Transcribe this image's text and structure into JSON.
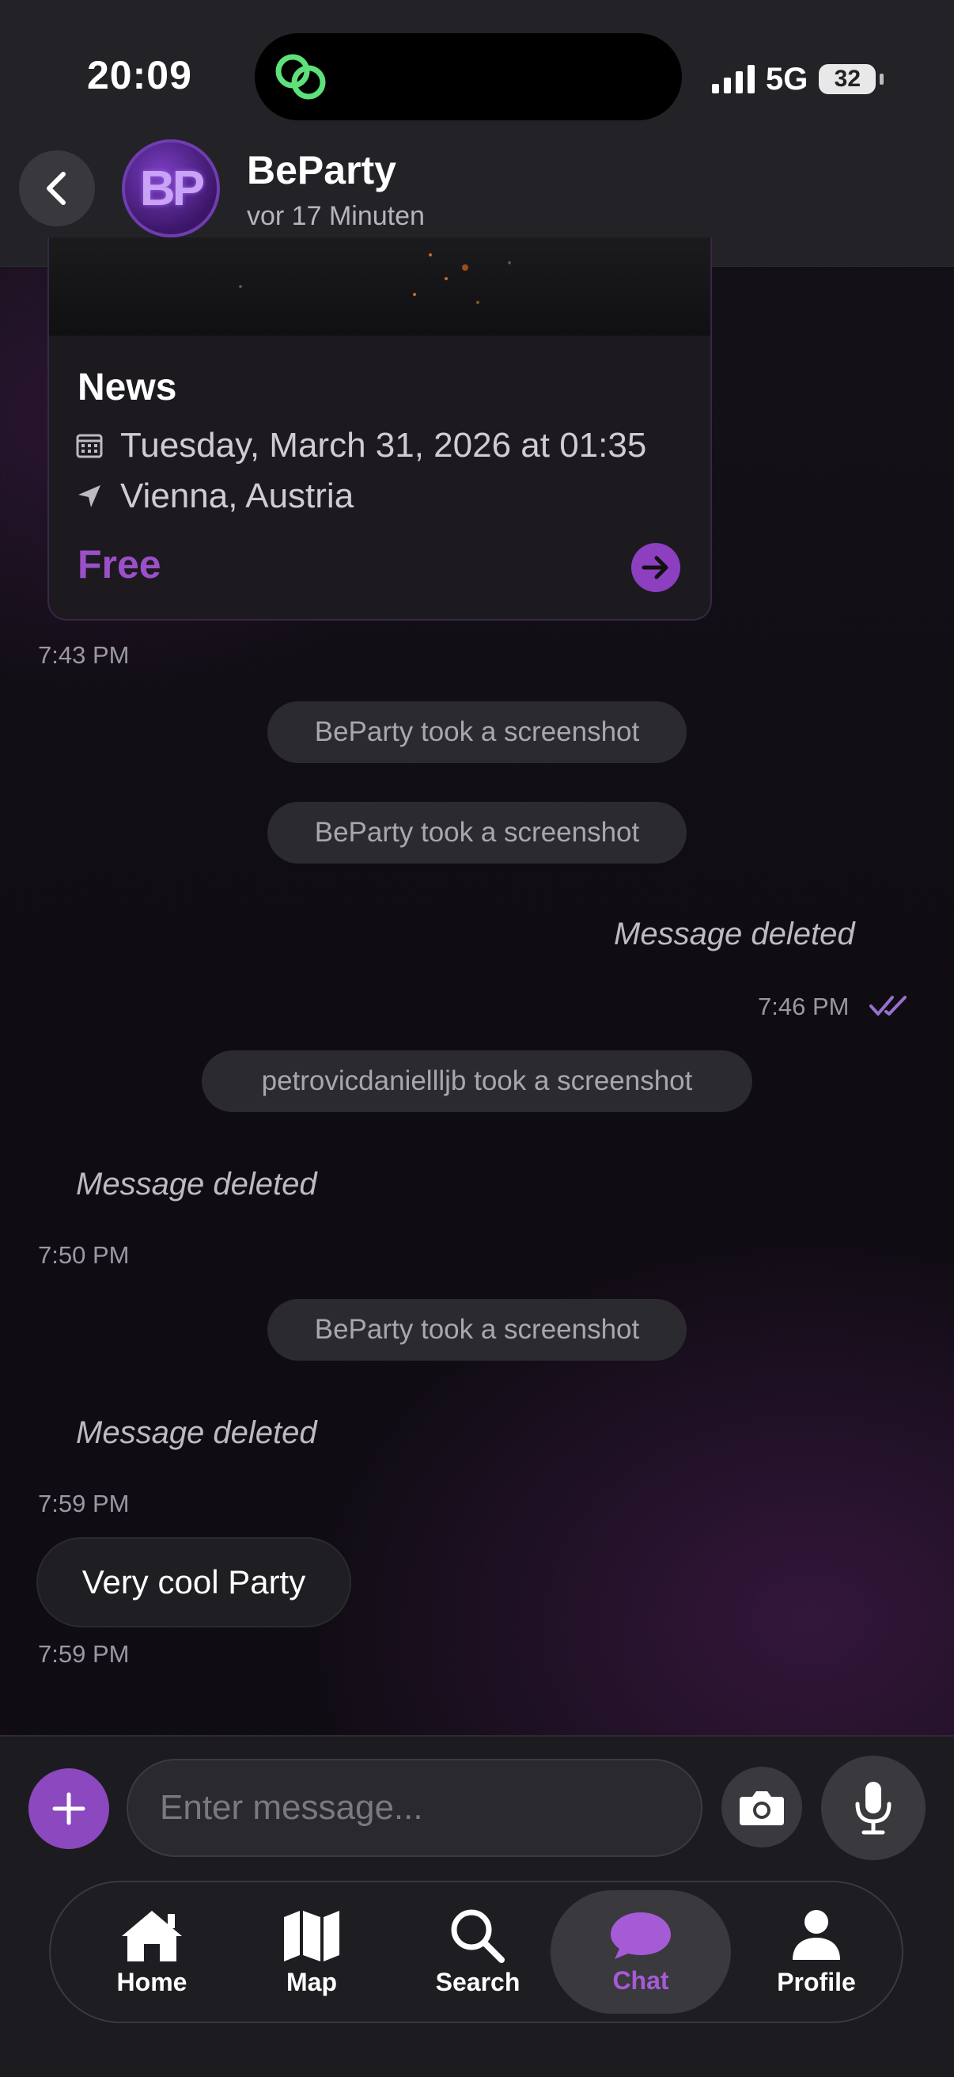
{
  "status_bar": {
    "time": "20:09",
    "network": "5G",
    "battery": "32"
  },
  "header": {
    "name": "BeParty",
    "avatar_text": "BP",
    "last_seen": "vor 17 Minuten"
  },
  "event_card": {
    "title": "News",
    "date": "Tuesday, March 31, 2026 at 01:35",
    "location": "Vienna, Austria",
    "price": "Free"
  },
  "messages": {
    "ts1": "7:43 PM",
    "sys1": "BeParty took a screenshot",
    "sys2": "BeParty took a screenshot",
    "deleted_out": "Message deleted",
    "ts2": "7:46 PM",
    "sys3": "petrovicdaniellljb took a screenshot",
    "deleted_in1": "Message deleted",
    "ts3": "7:50 PM",
    "sys4": "BeParty took a screenshot",
    "deleted_in2": "Message deleted",
    "ts4": "7:59 PM",
    "bubble": "Very cool Party",
    "ts5": "7:59 PM"
  },
  "composer": {
    "placeholder": "Enter message..."
  },
  "tabs": [
    {
      "label": "Home",
      "icon": "home-icon"
    },
    {
      "label": "Map",
      "icon": "map-icon"
    },
    {
      "label": "Search",
      "icon": "search-icon"
    },
    {
      "label": "Chat",
      "icon": "chat-icon",
      "active": true
    },
    {
      "label": "Profile",
      "icon": "profile-icon"
    }
  ],
  "colors": {
    "accent": "#9b4fc8",
    "active_tab": "#a55bd6",
    "read_check": "#9b6fd0"
  }
}
